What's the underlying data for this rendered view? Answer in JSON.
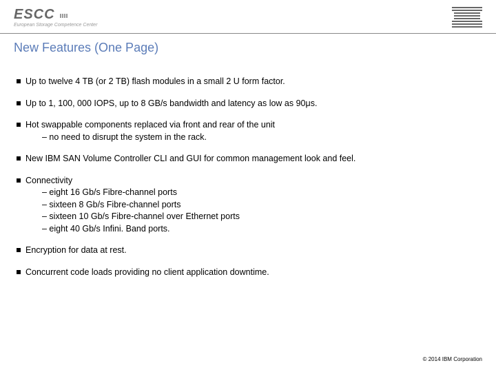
{
  "header": {
    "escc_main": "ESCC",
    "escc_sub": "European Storage Competence Center",
    "ibm_alt": "IBM"
  },
  "title": "New Features (One Page)",
  "bullets": [
    {
      "text": "Up to twelve 4 TB (or 2 TB) flash modules in a small 2 U form factor.",
      "subs": []
    },
    {
      "text": "Up to 1, 100, 000 IOPS, up to 8 GB/s bandwidth and latency as low as 90μs.",
      "subs": []
    },
    {
      "text": "Hot swappable components replaced via front and rear of the unit",
      "subs": [
        "– no need to disrupt the system in the rack."
      ]
    },
    {
      "text": "New IBM SAN Volume Controller CLI and GUI for common management look and feel.",
      "subs": []
    },
    {
      "text": "Connectivity",
      "subs": [
        "– eight 16 Gb/s Fibre-channel ports",
        "– sixteen 8 Gb/s Fibre-channel ports",
        "– sixteen 10 Gb/s Fibre-channel over Ethernet ports",
        "– eight 40 Gb/s Infini. Band ports."
      ]
    },
    {
      "text": "Encryption for data at rest.",
      "subs": []
    },
    {
      "text": "Concurrent code loads providing no client application downtime.",
      "subs": []
    }
  ],
  "footer": "© 2014 IBM Corporation"
}
